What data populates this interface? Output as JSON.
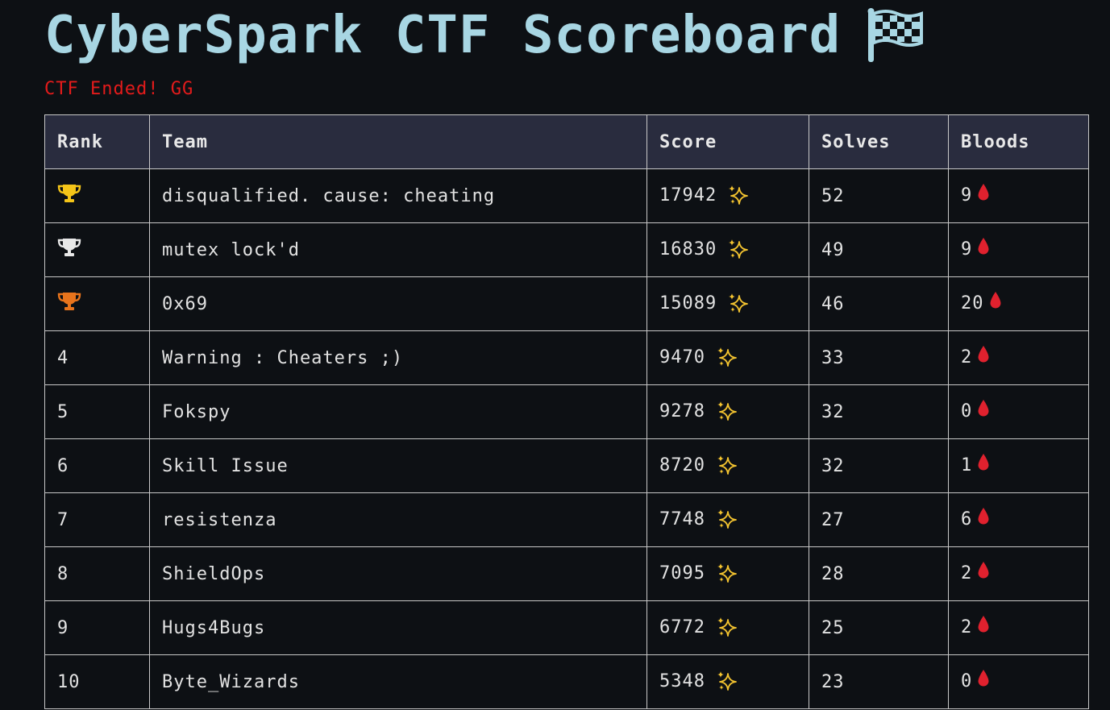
{
  "header": {
    "title": "CyberSpark CTF Scoreboard",
    "flag_icon": "checkered-flag-icon",
    "status": "CTF Ended! GG",
    "status_color": "#e31b1b",
    "title_color": "#a8d6e3"
  },
  "table": {
    "columns": [
      "Rank",
      "Team",
      "Score",
      "Solves",
      "Bloods"
    ],
    "header_bg": "#292c3e",
    "score_icon": "sparkles-icon",
    "bloods_icon": "blood-drop-icon",
    "rows": [
      {
        "rank": "",
        "rank_icon": "gold-trophy-icon",
        "trophy_color": "#f5c518",
        "team": "disqualified. cause: cheating",
        "score": "17942",
        "solves": "52",
        "bloods": "9"
      },
      {
        "rank": "",
        "rank_icon": "silver-trophy-icon",
        "trophy_color": "#e8e8e8",
        "team": "mutex lock'd",
        "score": "16830",
        "solves": "49",
        "bloods": "9"
      },
      {
        "rank": "",
        "rank_icon": "bronze-trophy-icon",
        "trophy_color": "#e8741c",
        "team": "0x69",
        "score": "15089",
        "solves": "46",
        "bloods": "20"
      },
      {
        "rank": "4",
        "team": "Warning : Cheaters ;)",
        "score": "9470",
        "solves": "33",
        "bloods": "2"
      },
      {
        "rank": "5",
        "team": "Fokspy",
        "score": "9278",
        "solves": "32",
        "bloods": "0"
      },
      {
        "rank": "6",
        "team": "Skill Issue",
        "score": "8720",
        "solves": "32",
        "bloods": "1"
      },
      {
        "rank": "7",
        "team": "resistenza",
        "score": "7748",
        "solves": "27",
        "bloods": "6"
      },
      {
        "rank": "8",
        "team": "ShieldOps",
        "score": "7095",
        "solves": "28",
        "bloods": "2"
      },
      {
        "rank": "9",
        "team": "Hugs4Bugs",
        "score": "6772",
        "solves": "25",
        "bloods": "2"
      },
      {
        "rank": "10",
        "team": "Byte_Wizards",
        "score": "5348",
        "solves": "23",
        "bloods": "0"
      }
    ]
  }
}
